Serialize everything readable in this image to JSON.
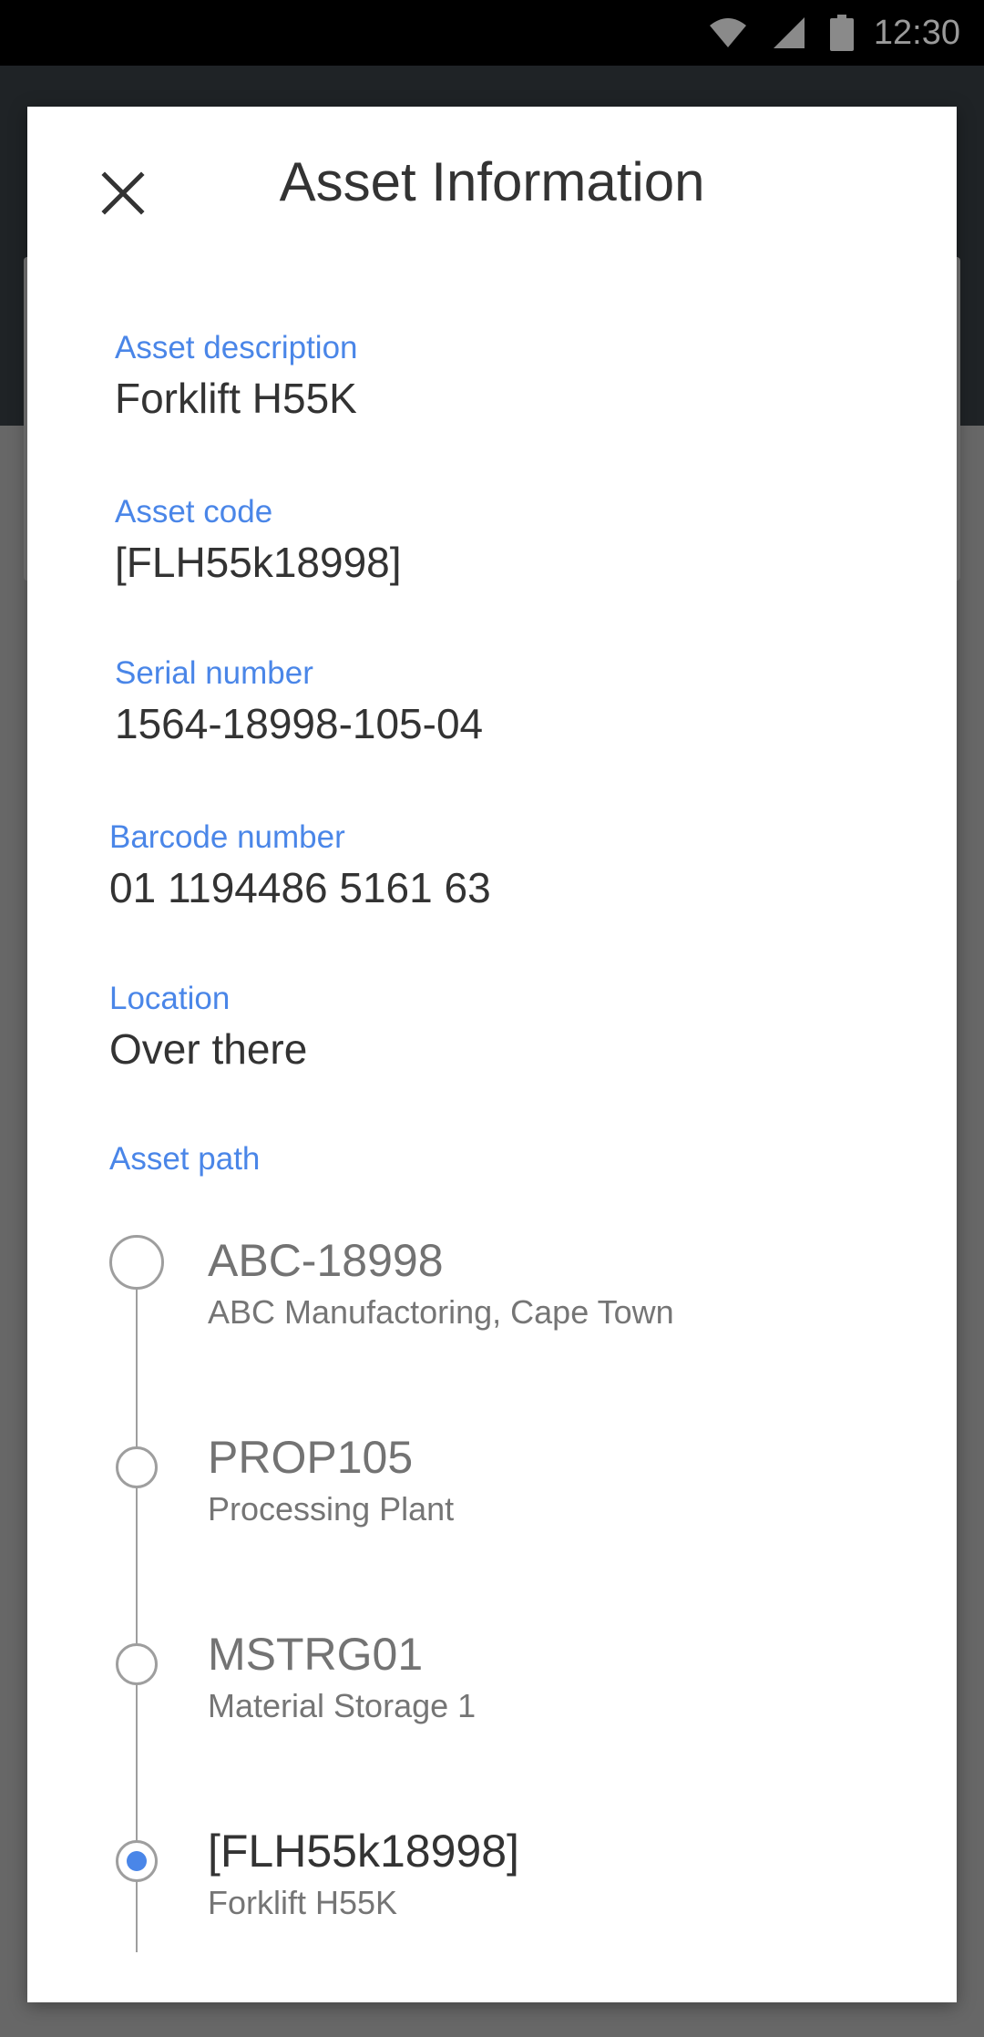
{
  "status_bar": {
    "time": "12:30",
    "icons": [
      "wifi-icon",
      "cell-signal-icon",
      "battery-icon"
    ]
  },
  "dialog": {
    "title": "Asset Information",
    "close_icon": "close-icon"
  },
  "fields": [
    {
      "label": "Asset description",
      "value": "Forklift H55K"
    },
    {
      "label": "Asset code",
      "value": "[FLH55k18998]"
    },
    {
      "label": "Serial number",
      "value": "1564-18998-105-04"
    },
    {
      "label": "Barcode number",
      "value": "01 1194486 5161 63"
    },
    {
      "label": "Location",
      "value": "Over there"
    }
  ],
  "asset_path": {
    "label": "Asset path",
    "items": [
      {
        "code": "ABC-18998",
        "name": "ABC Manufactoring, Cape Town",
        "current": false
      },
      {
        "code": "PROP105",
        "name": "Processing Plant",
        "current": false
      },
      {
        "code": "MSTRG01",
        "name": "Material Storage 1",
        "current": false
      },
      {
        "code": "[FLH55k18998]",
        "name": "Forklift H55K",
        "current": true
      }
    ]
  },
  "colors": {
    "accent": "#4a86e8",
    "status_bar": "#000000",
    "app_bar": "#1f2326",
    "scrim": "#676767",
    "dialog_bg": "#ffffff"
  }
}
